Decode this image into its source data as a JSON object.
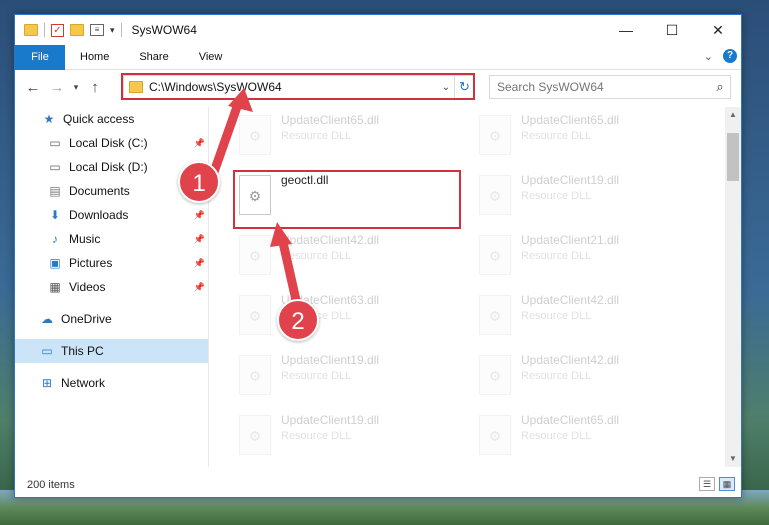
{
  "window": {
    "title": "SysWOW64",
    "controls": {
      "minimize": "—",
      "maximize": "☐",
      "close": "✕"
    }
  },
  "ribbon": {
    "tabs": [
      "File",
      "Home",
      "Share",
      "View"
    ],
    "help": "?"
  },
  "nav": {
    "address": "C:\\Windows\\SysWOW64",
    "search_placeholder": "Search SysWOW64"
  },
  "sidebar": {
    "items": [
      {
        "label": "Quick access",
        "icon": "star-icon",
        "pinned": false
      },
      {
        "label": "Local Disk (C:)",
        "icon": "drive-icon",
        "pinned": true
      },
      {
        "label": "Local Disk (D:)",
        "icon": "drive-icon",
        "pinned": false
      },
      {
        "label": "Documents",
        "icon": "documents-icon",
        "pinned": true
      },
      {
        "label": "Downloads",
        "icon": "download-icon",
        "pinned": true
      },
      {
        "label": "Music",
        "icon": "music-icon",
        "pinned": true
      },
      {
        "label": "Pictures",
        "icon": "pictures-icon",
        "pinned": true
      },
      {
        "label": "Videos",
        "icon": "videos-icon",
        "pinned": true
      },
      {
        "label": "OneDrive",
        "icon": "cloud-icon",
        "pinned": false
      },
      {
        "label": "This PC",
        "icon": "computer-icon",
        "pinned": false,
        "selected": true
      },
      {
        "label": "Network",
        "icon": "network-icon",
        "pinned": false
      }
    ]
  },
  "files": [
    {
      "name": "UpdateClient65.dll",
      "type": "Resource DLL"
    },
    {
      "name": "UpdateClient65.dll",
      "type": "Resource DLL"
    },
    {
      "name": "geoctl.dll",
      "type": ""
    },
    {
      "name": "UpdateClient19.dll",
      "type": "Resource DLL"
    },
    {
      "name": "UpdateClient42.dll",
      "type": "Resource DLL"
    },
    {
      "name": "UpdateClient21.dll",
      "type": "Resource DLL"
    },
    {
      "name": "UpdateClient63.dll",
      "type": "Resource DLL"
    },
    {
      "name": "UpdateClient42.dll",
      "type": "Resource DLL"
    },
    {
      "name": "UpdateClient19.dll",
      "type": "Resource DLL"
    },
    {
      "name": "UpdateClient42.dll",
      "type": "Resource DLL"
    },
    {
      "name": "UpdateClient19.dll",
      "type": "Resource DLL"
    },
    {
      "name": "UpdateClient65.dll",
      "type": "Resource DLL"
    }
  ],
  "status": {
    "item_count": "200 items"
  },
  "callouts": [
    "1",
    "2"
  ],
  "colors": {
    "accent": "#1979ca",
    "highlight": "#d2303d",
    "badge": "#e0434c"
  }
}
